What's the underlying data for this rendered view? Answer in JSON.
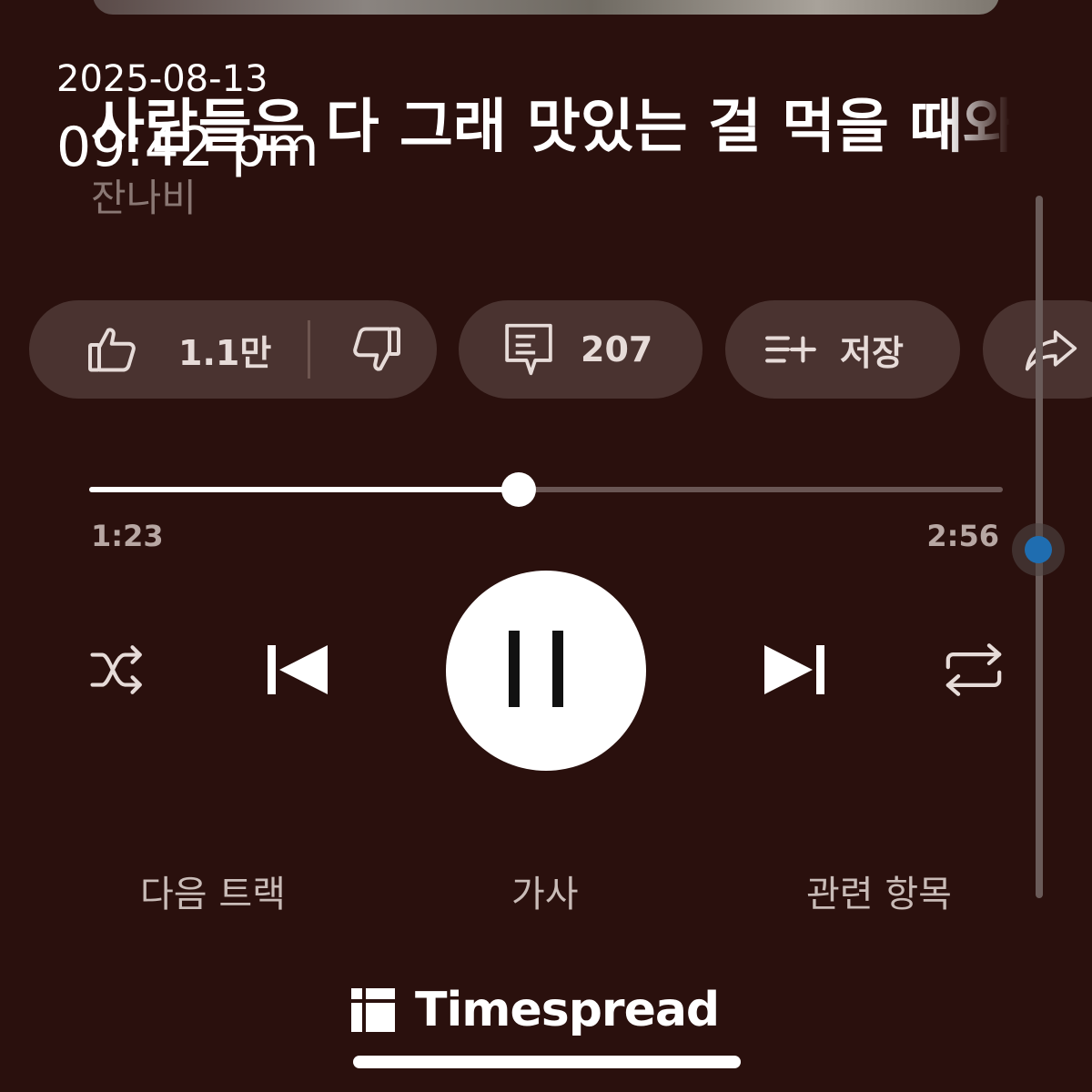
{
  "song": {
    "title": "사람들은 다 그래 맛있는 걸 먹을 때와",
    "artist": "잔나비"
  },
  "timestamp": {
    "date": "2025-08-13",
    "time": "09:42 pm"
  },
  "actions": {
    "like_count": "1.1만",
    "comment_count": "207",
    "save_label": "저장"
  },
  "player": {
    "current_time": "1:23",
    "total_time": "2:56",
    "progress": 0.47,
    "state": "playing"
  },
  "bottom_tabs": [
    "다음 트랙",
    "가사",
    "관련 항목"
  ],
  "brand": {
    "name": "Timespread"
  },
  "icons": {
    "like": "thumbs-up-icon",
    "dislike": "thumbs-down-icon",
    "comment": "comment-icon",
    "save": "playlist-add-icon",
    "share": "share-icon",
    "shuffle": "shuffle-icon",
    "previous": "skip-previous-icon",
    "pause": "pause-icon",
    "next": "skip-next-icon",
    "repeat": "repeat-icon"
  },
  "colors": {
    "background": "#2a100d",
    "pill": "#4a3330",
    "accent_dot": "#1f6db0"
  }
}
